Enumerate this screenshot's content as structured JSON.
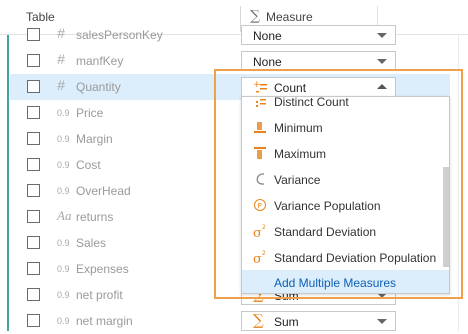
{
  "header": {
    "table_label": "Table",
    "measure_label": "Measure",
    "sigma": "∑"
  },
  "rows": [
    {
      "type_icon": "#",
      "name": "salesPersonKey",
      "measure": "None"
    },
    {
      "type_icon": "#",
      "name": "manfKey",
      "measure": "None"
    },
    {
      "type_icon": "#",
      "name": "Quantity",
      "measure": "Count"
    },
    {
      "type_icon": "0.9",
      "name": "Price"
    },
    {
      "type_icon": "0.9",
      "name": "Margin"
    },
    {
      "type_icon": "0.9",
      "name": "Cost"
    },
    {
      "type_icon": "0.9",
      "name": "OverHead"
    },
    {
      "type_icon": "Aa",
      "name": "returns"
    },
    {
      "type_icon": "0.9",
      "name": "Sales"
    },
    {
      "type_icon": "0.9",
      "name": "Expenses"
    },
    {
      "type_icon": "0.9",
      "name": "net profit",
      "measure": "Sum"
    },
    {
      "type_icon": "0.9",
      "name": "net margin",
      "measure": "Sum"
    }
  ],
  "dropdown": {
    "options": [
      {
        "label": "Distinct Count",
        "icon": "distinct-count-icon"
      },
      {
        "label": "Minimum",
        "icon": "minimum-icon"
      },
      {
        "label": "Maximum",
        "icon": "maximum-icon"
      },
      {
        "label": "Variance",
        "icon": "variance-icon"
      },
      {
        "label": "Variance Population",
        "icon": "variance-population-icon"
      },
      {
        "label": "Standard Deviation",
        "icon": "standard-deviation-icon"
      },
      {
        "label": "Standard Deviation Population",
        "icon": "standard-deviation-population-icon"
      },
      {
        "label": "Add Multiple Measures",
        "icon": ""
      }
    ]
  },
  "colors": {
    "accent": "#e8841d",
    "highlight_border": "#f0a04a",
    "selection": "#dceefc",
    "rail": "#3fa49c"
  }
}
